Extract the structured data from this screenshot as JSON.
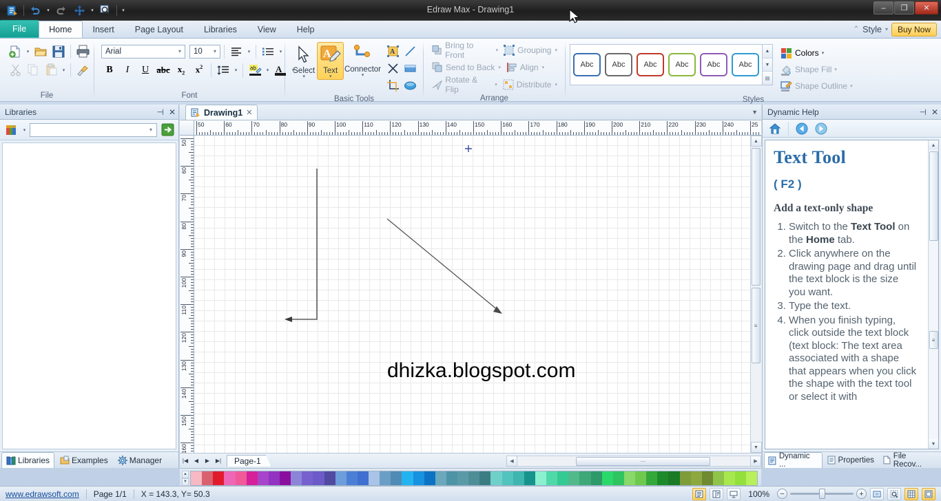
{
  "window": {
    "title": "Edraw Max - Drawing1",
    "minimize": "–",
    "maximize": "❐",
    "close": "✕"
  },
  "quick_access": {
    "items": [
      {
        "name": "edraw-logo-icon",
        "label": ""
      },
      {
        "name": "undo-icon",
        "label": ""
      },
      {
        "name": "redo-icon",
        "label": ""
      },
      {
        "name": "move-icon",
        "label": ""
      },
      {
        "name": "zoom-icon",
        "label": ""
      }
    ]
  },
  "ribbon_tabs": {
    "file": "File",
    "items": [
      "Home",
      "Insert",
      "Page Layout",
      "Libraries",
      "View",
      "Help"
    ],
    "active": "Home",
    "style_label": "Style",
    "buy_now": "Buy Now"
  },
  "ribbon": {
    "groups": [
      {
        "label": "File"
      },
      {
        "label": "Font"
      },
      {
        "label": "Basic Tools"
      },
      {
        "label": "Arrange"
      },
      {
        "label": "Styles"
      }
    ],
    "font": {
      "family": "Arial",
      "size": "10"
    },
    "basic_tools": {
      "select": "Select",
      "text": "Text",
      "connector": "Connector"
    },
    "arrange": {
      "bring_to_front": "Bring to Front",
      "send_to_back": "Send to Back",
      "rotate_flip": "Rotate & Flip",
      "grouping": "Grouping",
      "align": "Align",
      "distribute": "Distribute"
    },
    "styles": {
      "samples": [
        {
          "label": "Abc",
          "color": "#3a6fb0"
        },
        {
          "label": "Abc",
          "color": "#6a6a6a"
        },
        {
          "label": "Abc",
          "color": "#c0392b"
        },
        {
          "label": "Abc",
          "color": "#8cb83b"
        },
        {
          "label": "Abc",
          "color": "#8d5cb5"
        },
        {
          "label": "Abc",
          "color": "#2f9bd0"
        }
      ],
      "colors": "Colors",
      "shape_fill": "Shape Fill",
      "shape_outline": "Shape Outline"
    }
  },
  "left_panel": {
    "title": "Libraries",
    "pin": "⊣",
    "close": "✕",
    "search_value": "",
    "tabs": [
      {
        "label": "Libraries",
        "icon": "libraries-icon",
        "active": true
      },
      {
        "label": "Examples",
        "icon": "examples-icon",
        "active": false
      },
      {
        "label": "Manager",
        "icon": "manager-icon",
        "active": false
      }
    ]
  },
  "document": {
    "tab_label": "Drawing1",
    "tab_close": "✕",
    "page_tab": "Page-1",
    "canvas_text": "dhizka.blogspot.com"
  },
  "rulers": {
    "horizontal": [
      "50",
      "60",
      "70",
      "80",
      "90",
      "100",
      "110",
      "120",
      "130",
      "140",
      "150",
      "160",
      "170",
      "180",
      "190",
      "200",
      "210",
      "220",
      "230",
      "240",
      "25"
    ],
    "vertical": [
      "50",
      "60",
      "70",
      "80",
      "90",
      "100",
      "110",
      "120",
      "130",
      "140",
      "150",
      "160"
    ]
  },
  "right_panel": {
    "title": "Dynamic Help",
    "pin": "⊣",
    "close": "✕",
    "nav": [
      "home-icon",
      "back-icon",
      "forward-icon"
    ],
    "heading": "Text Tool",
    "shortcut": "( F2 )",
    "subheading": "Add a text-only shape",
    "steps": [
      "Switch to the <b>Text Tool</b> on the <b>Home</b> tab.",
      "Click anywhere on the drawing page and drag until the text block is the size you want.",
      "Type the text.",
      "When you finish typing, click outside the text block (text block: The text area associated with a shape that appears when you click the shape with the text tool or select it with"
    ],
    "tabs": [
      {
        "label": "Dynamic ...",
        "active": true
      },
      {
        "label": "Properties",
        "active": false
      },
      {
        "label": "File Recov...",
        "active": false
      }
    ]
  },
  "palette": {
    "colors": [
      "#f7b9c4",
      "#d9616f",
      "#e01b2d",
      "#ee66b5",
      "#f05a9b",
      "#d4219a",
      "#a844c9",
      "#9333c2",
      "#8a0f9e",
      "#8b84d8",
      "#7661cf",
      "#6c5ac8",
      "#514aa0",
      "#6e9ddb",
      "#4b7fd6",
      "#3f6fd0",
      "#a9c4e6",
      "#6b9ec4",
      "#4f8bb4",
      "#23b4f0",
      "#1792e0",
      "#0c73c4",
      "#6ba8bc",
      "#4f93a6",
      "#5a9aa8",
      "#4e8f97",
      "#3c7d84",
      "#6fd0ca",
      "#53c3bd",
      "#3fb5b0",
      "#17938e",
      "#8bf0cf",
      "#4fd9a8",
      "#35c994",
      "#52b98c",
      "#3ea878",
      "#2e9a6a",
      "#2bd96b",
      "#2ec45f",
      "#89d86a",
      "#6fc94f",
      "#34a83a",
      "#1d8a2a",
      "#1a7a26",
      "#7f9c3b",
      "#8da83f",
      "#6f8a30",
      "#8fc44a",
      "#a8e84f",
      "#93e03c",
      "#b6f05a"
    ]
  },
  "status_bar": {
    "website": "www.edrawsoft.com",
    "page": "Page 1/1",
    "coords": "X = 143.3, Y= 50.3",
    "zoom": "100%",
    "zoom_out": "−",
    "zoom_in": "+",
    "view_buttons": [
      "page-view-icon",
      "split-view-icon",
      "presentation-icon"
    ],
    "right_buttons": [
      "fit-page-icon",
      "zoom-select-icon",
      "grid-icon",
      "page-border-icon"
    ]
  }
}
